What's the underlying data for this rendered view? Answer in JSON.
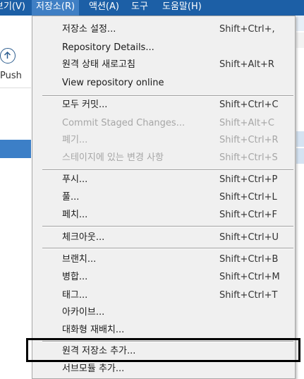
{
  "menubar": {
    "items": [
      "보기(V)",
      "저장소(R)",
      "액션(A)",
      "도구",
      "도움말(H)"
    ]
  },
  "left_panel": {
    "push_label": "Push"
  },
  "repository_menu": {
    "items": [
      {
        "label": "저장소 설정...",
        "shortcut": "Shift+Ctrl+,",
        "enabled": true
      },
      {
        "label": "Repository Details...",
        "shortcut": "",
        "enabled": true
      },
      {
        "label": "원격 상태 새로고침",
        "shortcut": "Shift+Alt+R",
        "enabled": true
      },
      {
        "label": "View repository online",
        "shortcut": "",
        "enabled": true
      },
      {
        "label": "모두 커밋...",
        "shortcut": "Shift+Ctrl+C",
        "enabled": true
      },
      {
        "label": "Commit Staged Changes...",
        "shortcut": "Shift+Alt+C",
        "enabled": false
      },
      {
        "label": "폐기...",
        "shortcut": "Shift+Ctrl+R",
        "enabled": false
      },
      {
        "label": "스테이지에 있는 변경 사항",
        "shortcut": "Shift+Ctrl+S",
        "enabled": false
      },
      {
        "label": "푸시...",
        "shortcut": "Shift+Ctrl+P",
        "enabled": true
      },
      {
        "label": "풀...",
        "shortcut": "Shift+Ctrl+L",
        "enabled": true
      },
      {
        "label": "페치...",
        "shortcut": "Shift+Ctrl+F",
        "enabled": true
      },
      {
        "label": "체크아웃...",
        "shortcut": "Shift+Ctrl+U",
        "enabled": true
      },
      {
        "label": "브랜치...",
        "shortcut": "Shift+Ctrl+B",
        "enabled": true
      },
      {
        "label": "병합...",
        "shortcut": "Shift+Ctrl+M",
        "enabled": true
      },
      {
        "label": "태그...",
        "shortcut": "Shift+Ctrl+T",
        "enabled": true
      },
      {
        "label": "아카이브...",
        "shortcut": "",
        "enabled": true
      },
      {
        "label": "대화형 재배치...",
        "shortcut": "",
        "enabled": true
      },
      {
        "label": "원격 저장소 추가...",
        "shortcut": "",
        "enabled": true
      },
      {
        "label": "서브모듈 추가...",
        "shortcut": "",
        "enabled": true
      }
    ]
  }
}
